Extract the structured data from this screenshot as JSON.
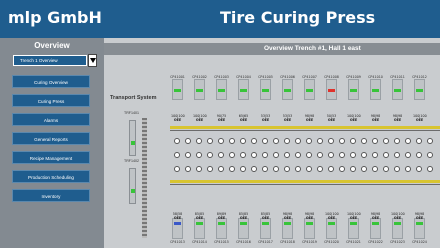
{
  "header": {
    "company": "mlp GmbH",
    "title": "Tire Curing Press"
  },
  "nav": {
    "title": "Overview",
    "dropdown_value": "Trench 1 Overview",
    "items": [
      {
        "label": "Curing Overview"
      },
      {
        "label": "Curing Press"
      },
      {
        "label": "Alarms"
      },
      {
        "label": "General Reports"
      },
      {
        "label": "Recipe Management"
      },
      {
        "label": "Production Scheduling"
      },
      {
        "label": "Inventory"
      }
    ]
  },
  "main": {
    "overview_title": "Overview Trench #1, Hall 1 east",
    "transport_title": "Transport System",
    "tracks": [
      {
        "label": "TRF1401"
      },
      {
        "label": "TRF1402"
      }
    ],
    "top_presses": [
      {
        "name": "CP41001",
        "v1": "100|100",
        "v2": "OEE",
        "bar": "green"
      },
      {
        "name": "CP41002",
        "v1": "100|100",
        "v2": "OEE",
        "bar": "green"
      },
      {
        "name": "CP41003",
        "v1": "90|75",
        "v2": "OEE",
        "bar": "green"
      },
      {
        "name": "CP41004",
        "v1": "65|65",
        "v2": "OEE",
        "bar": "green"
      },
      {
        "name": "CP41005",
        "v1": "53|53",
        "v2": "OEE",
        "bar": "green"
      },
      {
        "name": "CP41006",
        "v1": "53|53",
        "v2": "OEE",
        "bar": "green"
      },
      {
        "name": "CP41007",
        "v1": "98|98",
        "v2": "OEE",
        "bar": "green"
      },
      {
        "name": "CP41008",
        "v1": "50|53",
        "v2": "OEE",
        "bar": "red"
      },
      {
        "name": "CP41009",
        "v1": "100|100",
        "v2": "OEE",
        "bar": "green"
      },
      {
        "name": "CP41010",
        "v1": "98|98",
        "v2": "OEE",
        "bar": "green"
      },
      {
        "name": "CP41011",
        "v1": "98|98",
        "v2": "OEE",
        "bar": "green"
      },
      {
        "name": "CP41012",
        "v1": "100|100",
        "v2": "OEE",
        "bar": "green"
      }
    ],
    "bottom_presses": [
      {
        "name": "CP41013",
        "v1": "58|58",
        "v2": "OEE",
        "bar": "blue"
      },
      {
        "name": "CP41014",
        "v1": "85|85",
        "v2": "OEE",
        "bar": "green"
      },
      {
        "name": "CP41015",
        "v1": "89|89",
        "v2": "OEE",
        "bar": "green"
      },
      {
        "name": "CP41016",
        "v1": "85|85",
        "v2": "OEE",
        "bar": "green"
      },
      {
        "name": "CP41017",
        "v1": "85|85",
        "v2": "OEE",
        "bar": "green"
      },
      {
        "name": "CP41018",
        "v1": "98|98",
        "v2": "OEE",
        "bar": "green"
      },
      {
        "name": "CP41019",
        "v1": "98|98",
        "v2": "OEE",
        "bar": "green"
      },
      {
        "name": "CP41020",
        "v1": "100|100",
        "v2": "OEE",
        "bar": "green"
      },
      {
        "name": "CP41021",
        "v1": "100|100",
        "v2": "OEE",
        "bar": "green"
      },
      {
        "name": "CP41022",
        "v1": "98|98",
        "v2": "OEE",
        "bar": "green"
      },
      {
        "name": "CP41023",
        "v1": "100|100",
        "v2": "OEE",
        "bar": "green"
      },
      {
        "name": "CP41024",
        "v1": "98|98",
        "v2": "OEE",
        "bar": "green"
      }
    ],
    "colors": {
      "green": "#38c43a",
      "red": "#e0322c",
      "blue": "#3a58c8",
      "yellow": "#d8c430"
    }
  }
}
